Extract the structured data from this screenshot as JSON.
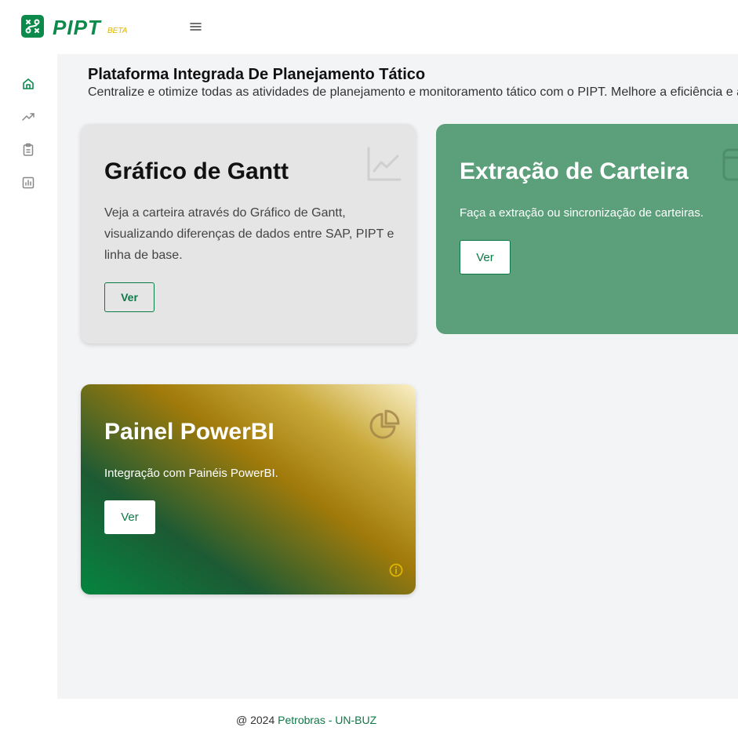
{
  "colors": {
    "brand_green": "#0c8a4b",
    "beta_yellow": "#e0b400",
    "main_bg": "#f3f4f6",
    "gantt_card_bg": "#e5e5e5",
    "extract_card_bg": "#5c9f7b",
    "info_icon": "#e0b400"
  },
  "header": {
    "brand": "PIPT",
    "beta": "BETA",
    "logo_icon": "route-icon",
    "menu_icon": "hamburger-menu-icon"
  },
  "sidebar": {
    "items": [
      {
        "icon": "home-icon",
        "active": true
      },
      {
        "icon": "trending-up-icon",
        "active": false
      },
      {
        "icon": "clipboard-icon",
        "active": false
      },
      {
        "icon": "bar-chart-icon",
        "active": false
      }
    ]
  },
  "main": {
    "title": "Plataforma Integrada De Planejamento Tático",
    "subtitle": "Centralize e otimize todas as atividades de planejamento e monitoramento tático com o PIPT. Melhore a eficiência e a",
    "cards": [
      {
        "title": "Gráfico de Gantt",
        "description": "Veja a carteira através do Gráfico de Gantt, visualizando diferenças de dados entre SAP, PIPT e linha de base.",
        "button": "Ver",
        "icon": "line-chart-icon"
      },
      {
        "title": "Extração de Carteira",
        "description": "Faça a extração ou sincronização de carteiras.",
        "button": "Ver",
        "icon": "window-icon"
      },
      {
        "title": "Painel PowerBI",
        "description": "Integração com Painéis PowerBI.",
        "button": "Ver",
        "icon": "pie-chart-icon",
        "info_icon": "info-icon"
      }
    ]
  },
  "footer": {
    "prefix": "@ 2024 ",
    "link": "Petrobras - UN-BUZ"
  }
}
